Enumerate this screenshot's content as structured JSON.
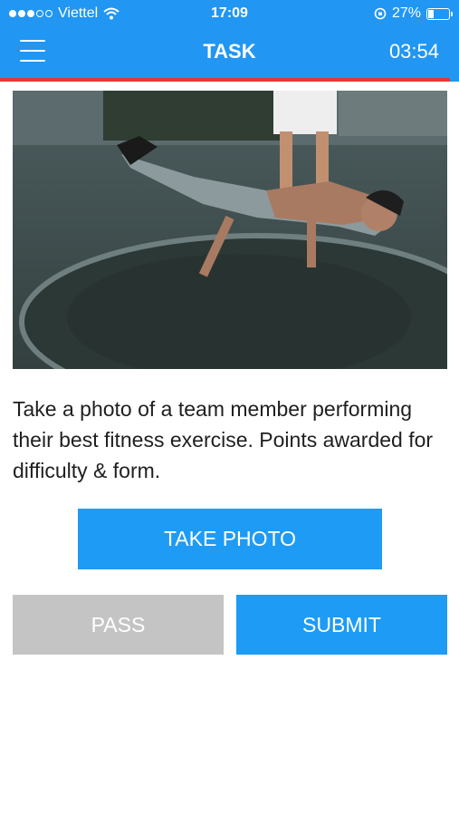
{
  "status_bar": {
    "carrier": "Viettel",
    "time": "17:09",
    "battery_text": "27%",
    "battery_level": 0.27,
    "signal_bars_filled": 3,
    "signal_bars_total": 5,
    "icons": [
      "signal-icon",
      "wifi-icon",
      "rotation-lock-icon",
      "battery-icon"
    ]
  },
  "nav": {
    "title": "TASK",
    "timer": "03:54",
    "menu_icon": "hamburger-menu-icon",
    "progress": 0.98
  },
  "task": {
    "image_description_icon": "task-photo",
    "description": "Take a photo of a team member performing their best fitness exercise. Points awarded for difficulty & form."
  },
  "buttons": {
    "take_photo": "TAKE PHOTO",
    "pass": "PASS",
    "submit": "SUBMIT"
  },
  "colors": {
    "header": "#2196f3",
    "primary_button": "#1e9bf5",
    "pass_button": "#c4c4c4",
    "progress": "#e53935"
  }
}
